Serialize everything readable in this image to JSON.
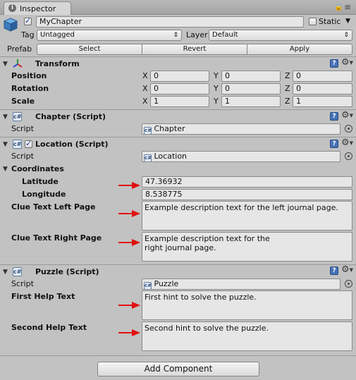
{
  "tab": {
    "title": "Inspector"
  },
  "header": {
    "name_value": "MyChapter",
    "static_label": "Static",
    "tag_label": "Tag",
    "tag_value": "Untagged",
    "layer_label": "Layer",
    "layer_value": "Default",
    "prefab_label": "Prefab",
    "prefab_buttons": [
      "Select",
      "Revert",
      "Apply"
    ]
  },
  "transform": {
    "title": "Transform",
    "rows": [
      {
        "label": "Position",
        "x": "0",
        "y": "0",
        "z": "0"
      },
      {
        "label": "Rotation",
        "x": "0",
        "y": "0",
        "z": "0"
      },
      {
        "label": "Scale",
        "x": "1",
        "y": "1",
        "z": "1"
      }
    ],
    "axis_x": "X",
    "axis_y": "Y",
    "axis_z": "Z"
  },
  "chapter": {
    "title": "Chapter (Script)",
    "script_label": "Script",
    "script_value": "Chapter"
  },
  "location": {
    "title": "Location (Script)",
    "script_label": "Script",
    "script_value": "Location",
    "coordinates_label": "Coordinates",
    "latitude_label": "Latitude",
    "latitude_value": "47.36932",
    "longitude_label": "Longitude",
    "longitude_value": "8.538775",
    "clue_left_label": "Clue Text Left Page",
    "clue_left_value": "Example description text for the left journal page.",
    "clue_right_label": "Clue Text Right Page",
    "clue_right_value": "Example description text for the\nright journal page."
  },
  "puzzle": {
    "title": "Puzzle (Script)",
    "script_label": "Script",
    "script_value": "Puzzle",
    "first_help_label": "First Help Text",
    "first_help_value": "First hint to solve the puzzle.",
    "second_help_label": "Second Help Text",
    "second_help_value": "Second hint to solve the puzzle."
  },
  "footer": {
    "add_component_label": "Add Component"
  },
  "colors": {
    "accent": "#4673b8",
    "annotation_arrow": "#e01010"
  }
}
